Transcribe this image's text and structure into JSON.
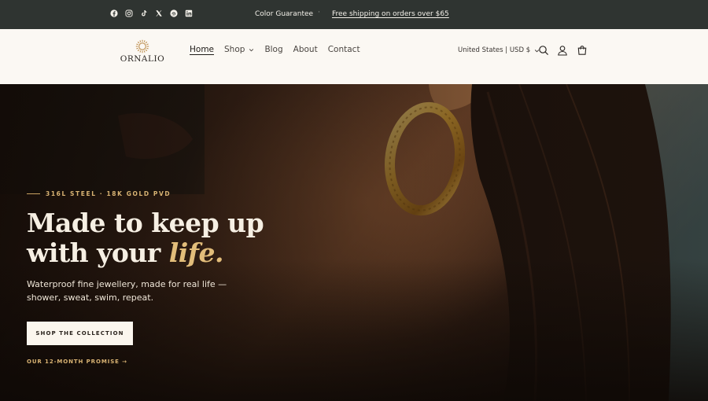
{
  "announcement": {
    "social_icons": [
      "facebook-icon",
      "instagram-icon",
      "tiktok-icon",
      "x-icon",
      "pinterest-icon",
      "linkedin-icon"
    ],
    "message_left": "Color Guarantee",
    "separator": "·",
    "message_link": "Free shipping on orders over $65"
  },
  "header": {
    "logo_text": "ORNALIO",
    "nav": {
      "home": "Home",
      "shop": "Shop",
      "blog": "Blog",
      "about": "About",
      "contact": "Contact"
    },
    "locale": "United States | USD $"
  },
  "hero": {
    "eyebrow": "316L STEEL · 18K GOLD PVD",
    "headline_line1": "Made to keep up",
    "headline_line2_prefix": "with your ",
    "headline_accent": "life.",
    "subcopy": "Waterproof fine jewellery, made for real life — shower, sweat, swim, repeat.",
    "cta_label": "SHOP THE COLLECTION",
    "secondary_link": "OUR 12-MONTH PROMISE →"
  },
  "colors": {
    "announcement_bg": "#2f3431",
    "header_bg": "#fbf8f3",
    "gold_accent": "#e2bd7a",
    "hero_text": "#f6efe3"
  }
}
